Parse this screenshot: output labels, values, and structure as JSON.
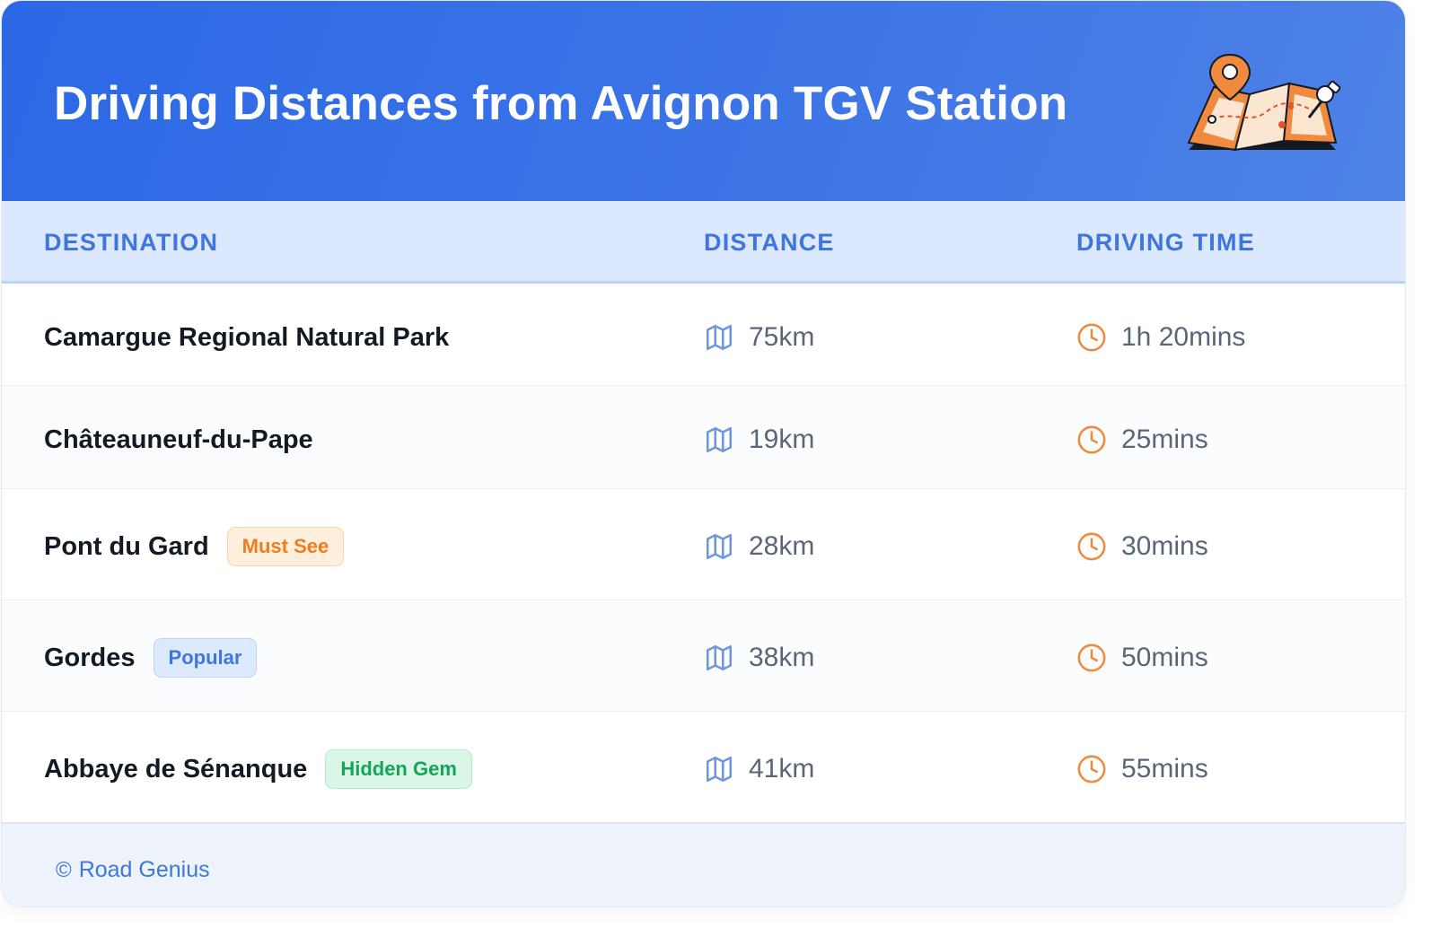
{
  "header": {
    "title": "Driving Distances from Avignon TGV Station",
    "illustration": "folded-map-with-location-pin"
  },
  "table": {
    "columns": [
      "DESTINATION",
      "DISTANCE",
      "DRIVING TIME"
    ],
    "rows": [
      {
        "destination": "Camargue Regional Natural Park",
        "badge": "",
        "distance": "75km",
        "time": "1h 20mins"
      },
      {
        "destination": "Châteauneuf-du-Pape",
        "badge": "",
        "distance": "19km",
        "time": "25mins"
      },
      {
        "destination": "Pont du Gard",
        "badge": "Must See",
        "distance": "28km",
        "time": "30mins"
      },
      {
        "destination": "Gordes",
        "badge": "Popular",
        "distance": "38km",
        "time": "50mins"
      },
      {
        "destination": "Abbaye de Sénanque",
        "badge": "Hidden Gem",
        "distance": "41km",
        "time": "55mins"
      }
    ]
  },
  "footer": {
    "copyright_symbol": "©",
    "brand": "Road Genius"
  },
  "icons": {
    "distance": "map-icon",
    "time": "clock-icon"
  },
  "colors": {
    "header_blue": "#2c68e6",
    "accent_blue": "#3e77dd",
    "accent_orange": "#ef7d1e",
    "accent_green": "#17a35a",
    "icon_blue": "#6f96dc",
    "icon_orange": "#f08a3e"
  }
}
